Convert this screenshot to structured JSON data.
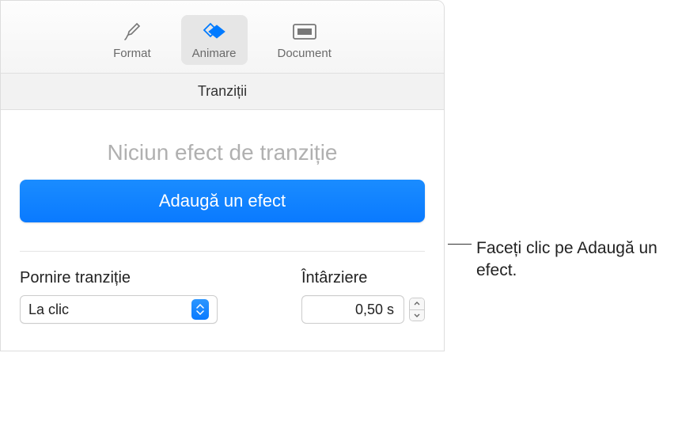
{
  "toolbar": {
    "format_label": "Format",
    "animate_label": "Animare",
    "document_label": "Document"
  },
  "section_title": "Tranziții",
  "no_effect_text": "Niciun efect de tranziție",
  "add_effect_label": "Adaugă un efect",
  "controls": {
    "start_label": "Pornire tranziție",
    "start_value": "La clic",
    "delay_label": "Întârziere",
    "delay_value": "0,50 s"
  },
  "callout": {
    "text": "Faceți clic pe Adaugă un efect."
  }
}
